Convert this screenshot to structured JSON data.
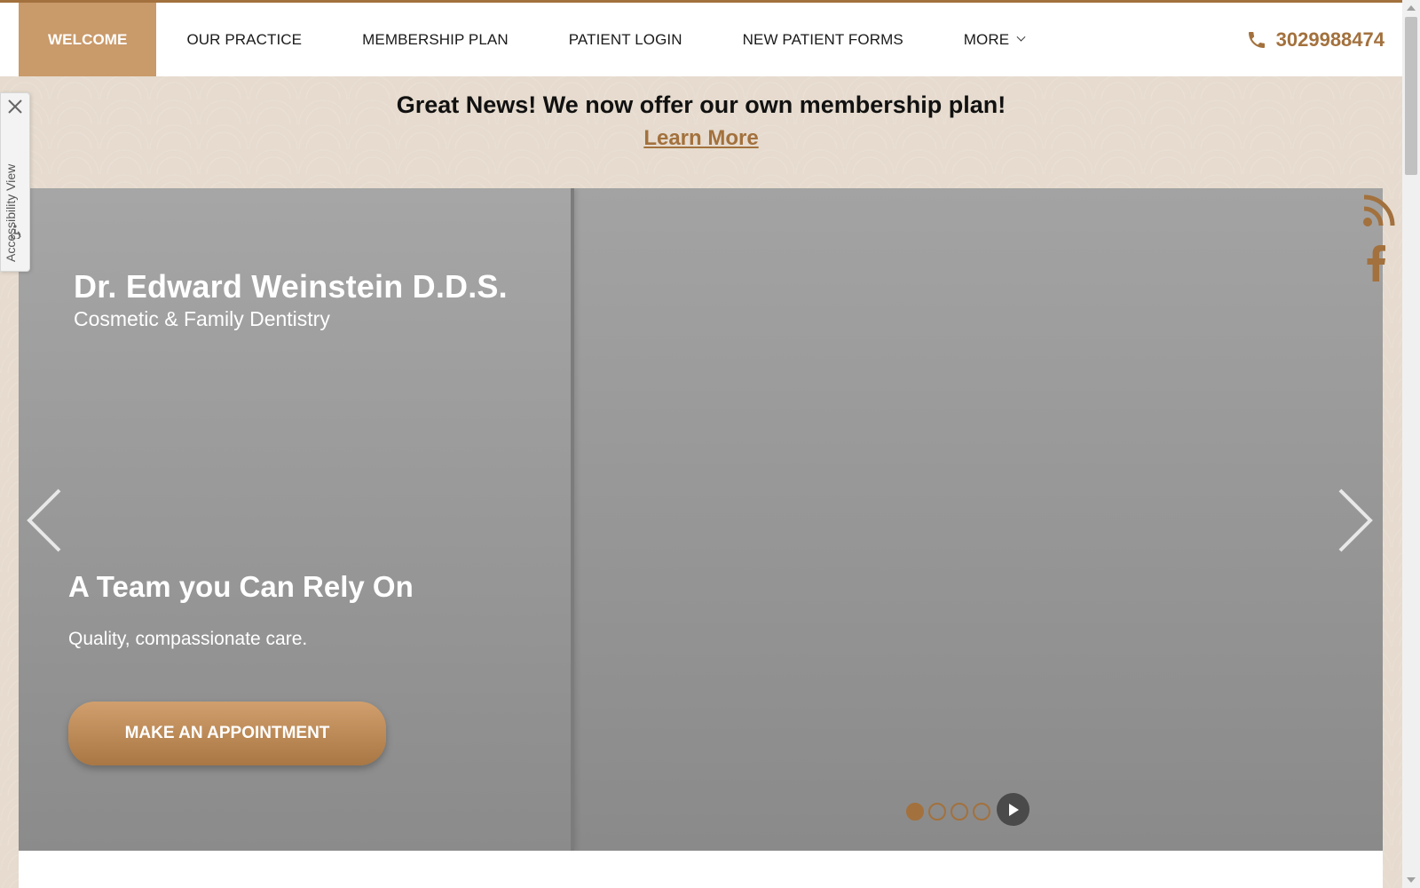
{
  "nav": {
    "items": [
      {
        "label": "WELCOME",
        "active": true
      },
      {
        "label": "OUR PRACTICE"
      },
      {
        "label": "MEMBERSHIP PLAN"
      },
      {
        "label": "PATIENT LOGIN"
      },
      {
        "label": "NEW PATIENT FORMS"
      },
      {
        "label": "MORE"
      }
    ],
    "phone": "3029988474"
  },
  "announcement": {
    "headline": "Great News! We now offer our own membership plan!",
    "link": "Learn More"
  },
  "hero": {
    "brand_name": "Dr. Edward Weinstein D.D.S.",
    "brand_sub": "Cosmetic & Family Dentistry",
    "slide_title": "A Team you Can Rely On",
    "slide_text": "Quality, compassionate care.",
    "cta": "MAKE AN APPOINTMENT",
    "slide_count": 4,
    "active_slide": 1
  },
  "accessibility": {
    "label": "Accessibility View"
  },
  "colors": {
    "accent": "#a3713d",
    "nav_active": "#c99a6a",
    "background": "#e6dbce"
  }
}
